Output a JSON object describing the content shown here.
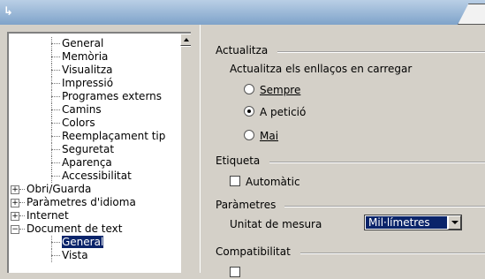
{
  "window": {
    "title_icon": "openoffice-icon"
  },
  "tree": {
    "items": [
      {
        "label": "General",
        "level": 1
      },
      {
        "label": "Memòria",
        "level": 1
      },
      {
        "label": "Visualitza",
        "level": 1
      },
      {
        "label": "Impressió",
        "level": 1
      },
      {
        "label": "Programes externs",
        "level": 1
      },
      {
        "label": "Camins",
        "level": 1
      },
      {
        "label": "Colors",
        "level": 1
      },
      {
        "label": "Reemplaçament tip",
        "level": 1
      },
      {
        "label": "Seguretat",
        "level": 1
      },
      {
        "label": "Aparença",
        "level": 1
      },
      {
        "label": "Accessibilitat",
        "level": 1
      },
      {
        "label": "Obri/Guarda",
        "level": 0,
        "expander": "⊞"
      },
      {
        "label": "Paràmetres d'idioma",
        "level": 0,
        "expander": "⊞"
      },
      {
        "label": "Internet",
        "level": 0,
        "expander": "⊞"
      },
      {
        "label": "Document de text",
        "level": 0,
        "expander": "⊟"
      },
      {
        "label": "General",
        "level": 1,
        "selected": true
      },
      {
        "label": "Vista",
        "level": 1
      }
    ]
  },
  "panel": {
    "actualitza": {
      "heading": "Actualitza",
      "sublabel": "Actualitza els enllaços en carregar",
      "options": [
        "Sempre",
        "A petició",
        "Mai"
      ],
      "selected": "A petició"
    },
    "etiqueta": {
      "heading": "Etiqueta",
      "checkbox": "Automàtic",
      "checked": false
    },
    "parametres": {
      "heading": "Paràmetres",
      "unit_label": "Unitat de mesura",
      "unit_value": "Mil·límetres"
    },
    "compatibilitat": {
      "heading": "Compatibilitat"
    }
  }
}
